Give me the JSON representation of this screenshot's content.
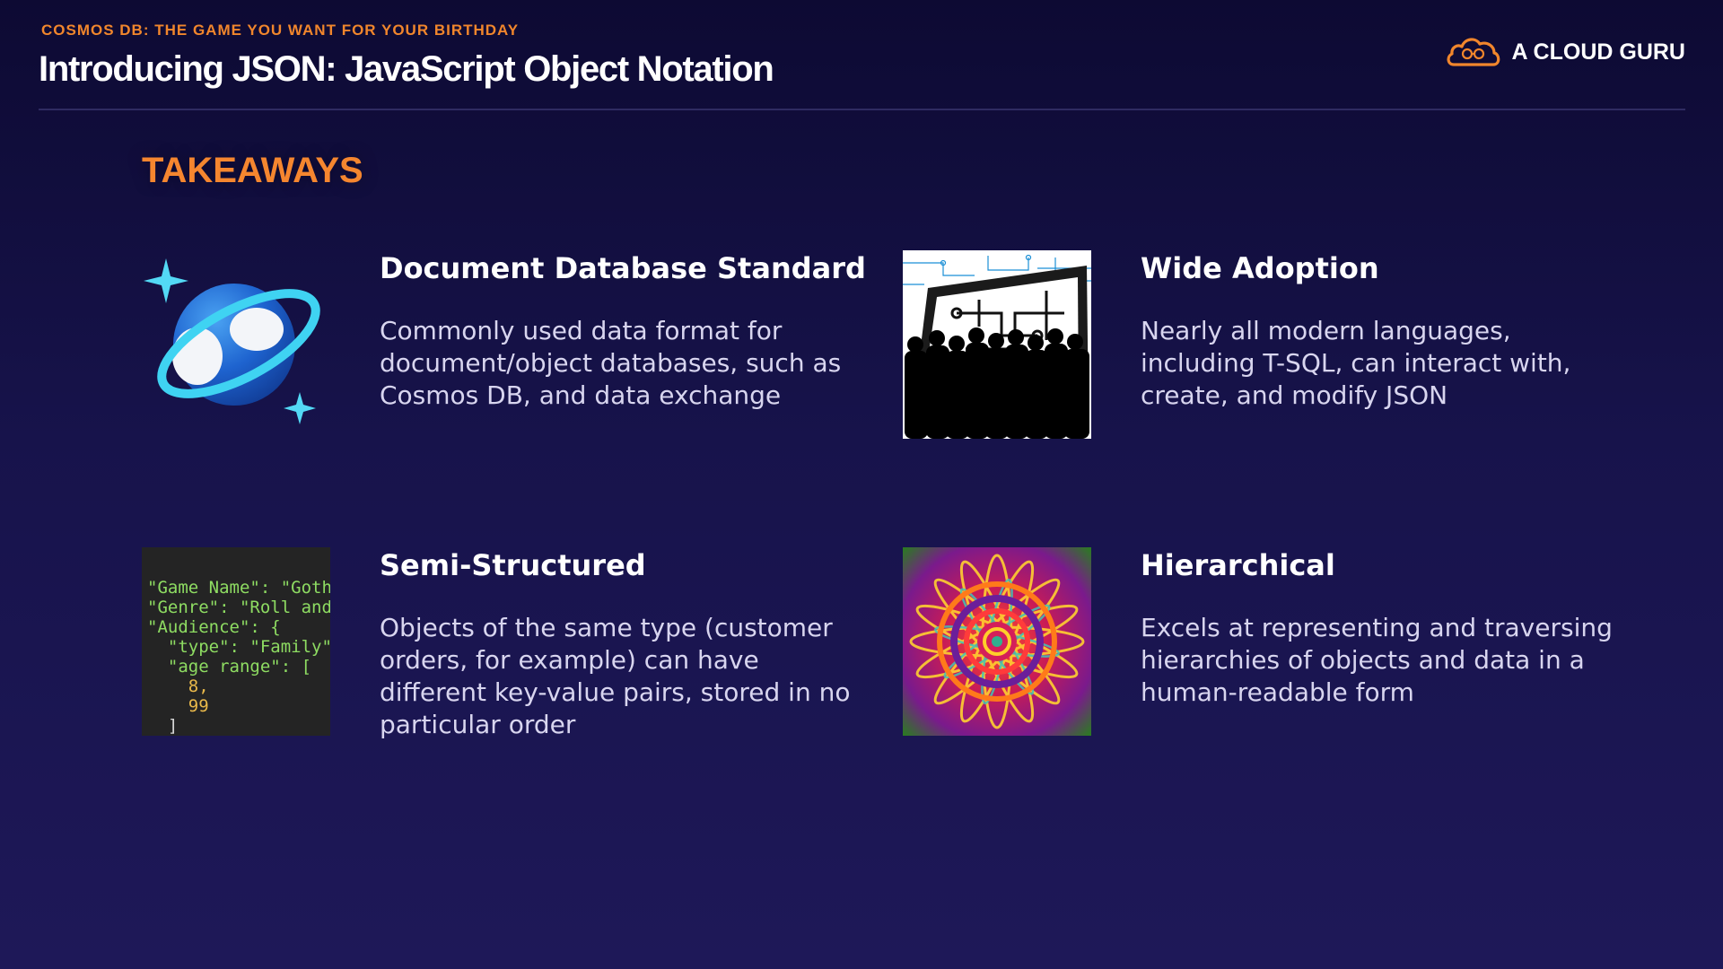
{
  "header": {
    "eyebrow": "COSMOS DB: THE GAME YOU WANT FOR YOUR BIRTHDAY",
    "title": "Introducing JSON: JavaScript Object Notation",
    "brand": "A CLOUD GURU"
  },
  "section": {
    "title": "TAKEAWAYS"
  },
  "cards": [
    {
      "title": "Document Database Standard",
      "text": "Commonly used data format for document/object databases, such as Cosmos DB, and data exchange"
    },
    {
      "title": "Wide Adoption",
      "text": "Nearly all modern languages, including T-SQL, can interact with, create, and modify JSON"
    },
    {
      "title": "Semi-Structured",
      "text": "Objects of the same type (customer orders, for example) can have different key-value pairs, stored in no particular order"
    },
    {
      "title": "Hierarchical",
      "text": "Excels at representing and traversing hierarchies of objects and data in a human-readable form"
    }
  ],
  "code_snippet": {
    "line1": "\"Game Name\": \"Goth",
    "line2": "\"Genre\": \"Roll and",
    "line3": "\"Audience\": {",
    "line4": "  \"type\": \"Family\"",
    "line5": "  \"age range\": [",
    "line6": "    8,",
    "line7": "    99",
    "line8": "  ]"
  },
  "colors": {
    "accent": "#f1862c",
    "background_top": "#0d0a33",
    "background_bottom": "#1e1858",
    "text_primary": "#ffffff",
    "text_secondary": "#d8d5ef"
  },
  "icons": {
    "brand_logo": "cloud-logo-icon",
    "card1": "cosmos-db-planet-icon",
    "card2": "crowd-circuit-image",
    "card3": "json-code-image",
    "card4": "mandala-pattern-image"
  }
}
